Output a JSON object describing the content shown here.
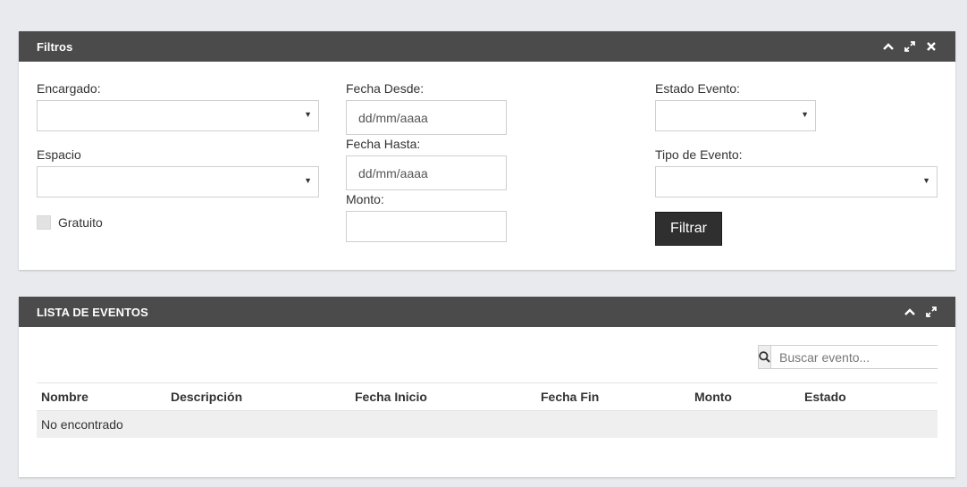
{
  "filters_panel": {
    "title": "Filtros",
    "icons": [
      "chevron-up-icon",
      "expand-icon",
      "close-icon"
    ],
    "encargado": {
      "label": "Encargado:",
      "value": ""
    },
    "espacio": {
      "label": "Espacio",
      "value": ""
    },
    "gratuito": {
      "label": "Gratuito",
      "checked": false
    },
    "fecha_desde": {
      "label": "Fecha Desde:",
      "placeholder": "dd/mm/aaaa"
    },
    "fecha_hasta": {
      "label": "Fecha Hasta:",
      "placeholder": "dd/mm/aaaa"
    },
    "monto": {
      "label": "Monto:",
      "value": ""
    },
    "estado_evento": {
      "label": "Estado Evento:",
      "value": ""
    },
    "tipo_evento": {
      "label": "Tipo de Evento:",
      "value": ""
    },
    "filter_button": "Filtrar"
  },
  "list_panel": {
    "title": "LISTA DE EVENTOS",
    "icons": [
      "chevron-up-icon",
      "expand-icon"
    ],
    "search": {
      "placeholder": "Buscar evento..."
    },
    "columns": [
      "Nombre",
      "Descripción",
      "Fecha Inicio",
      "Fecha Fin",
      "Monto",
      "Estado"
    ],
    "empty_message": "No encontrado"
  },
  "colors": {
    "header_bg": "#4b4b4b",
    "page_bg": "#e9eaee",
    "button_bg": "#2f2f2f"
  }
}
